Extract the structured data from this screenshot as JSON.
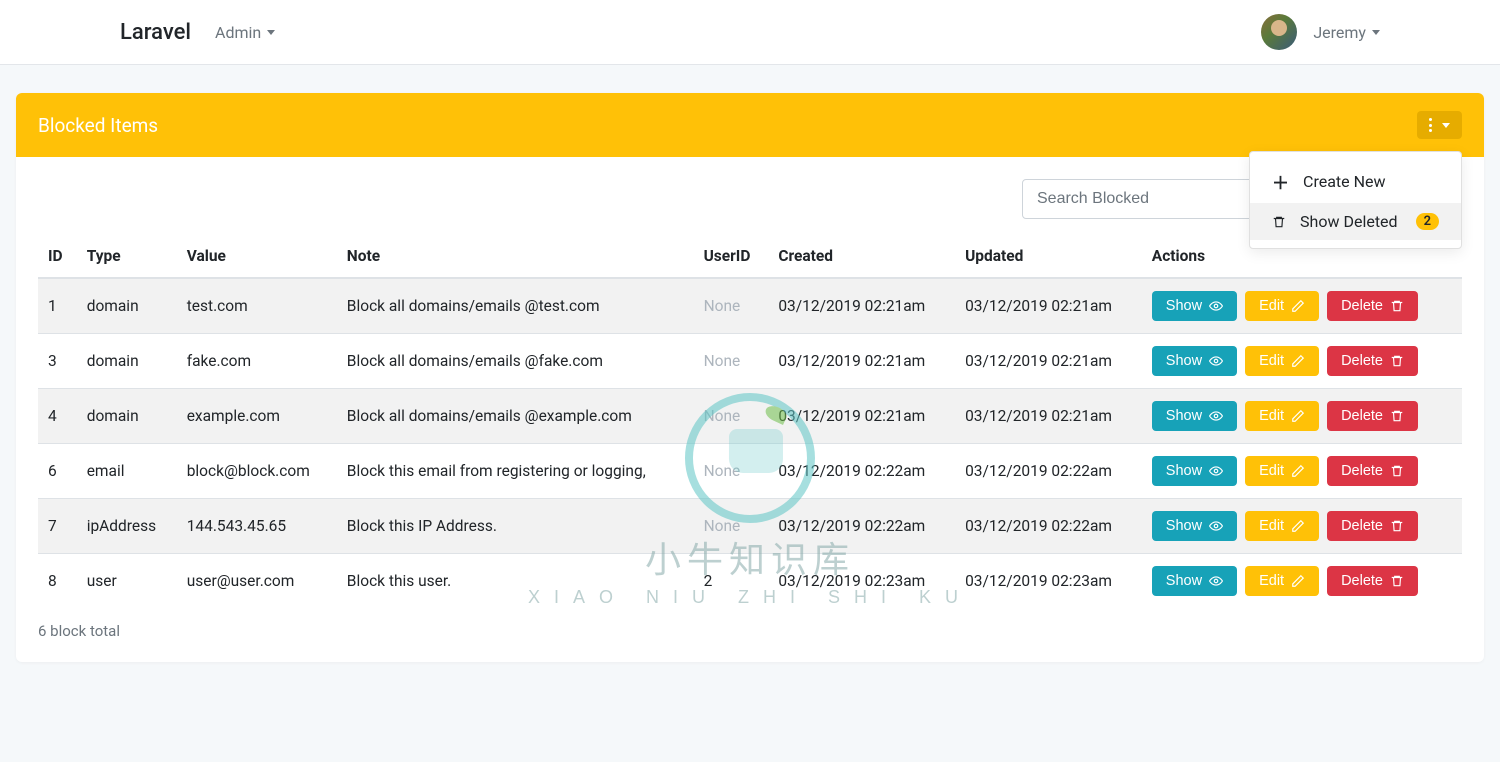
{
  "nav": {
    "brand": "Laravel",
    "admin_label": "Admin",
    "user_name": "Jeremy"
  },
  "card": {
    "title": "Blocked Items"
  },
  "dropdown": {
    "create_label": "Create New",
    "show_deleted_label": "Show Deleted",
    "deleted_count": "2"
  },
  "search": {
    "placeholder": "Search Blocked"
  },
  "table": {
    "headers": {
      "id": "ID",
      "type": "Type",
      "value": "Value",
      "note": "Note",
      "userid": "UserID",
      "created": "Created",
      "updated": "Updated",
      "actions": "Actions"
    },
    "rows": [
      {
        "id": "1",
        "type": "domain",
        "value": "test.com",
        "note": "Block all domains/emails @test.com",
        "userid": "None",
        "created": "03/12/2019 02:21am",
        "updated": "03/12/2019 02:21am"
      },
      {
        "id": "3",
        "type": "domain",
        "value": "fake.com",
        "note": "Block all domains/emails @fake.com",
        "userid": "None",
        "created": "03/12/2019 02:21am",
        "updated": "03/12/2019 02:21am"
      },
      {
        "id": "4",
        "type": "domain",
        "value": "example.com",
        "note": "Block all domains/emails @example.com",
        "userid": "None",
        "created": "03/12/2019 02:21am",
        "updated": "03/12/2019 02:21am"
      },
      {
        "id": "6",
        "type": "email",
        "value": "block@block.com",
        "note": "Block this email from registering or logging,",
        "userid": "None",
        "created": "03/12/2019 02:22am",
        "updated": "03/12/2019 02:22am"
      },
      {
        "id": "7",
        "type": "ipAddress",
        "value": "144.543.45.65",
        "note": "Block this IP Address.",
        "userid": "None",
        "created": "03/12/2019 02:22am",
        "updated": "03/12/2019 02:22am"
      },
      {
        "id": "8",
        "type": "user",
        "value": "user@user.com",
        "note": "Block this user.",
        "userid": "2",
        "created": "03/12/2019 02:23am",
        "updated": "03/12/2019 02:23am"
      }
    ]
  },
  "actions": {
    "show": "Show",
    "edit": "Edit",
    "delete": "Delete"
  },
  "footer": {
    "total_text": "6 block total"
  },
  "watermark": {
    "main": "小牛知识库",
    "sub": "XIAO NIU ZHI SHI KU"
  }
}
